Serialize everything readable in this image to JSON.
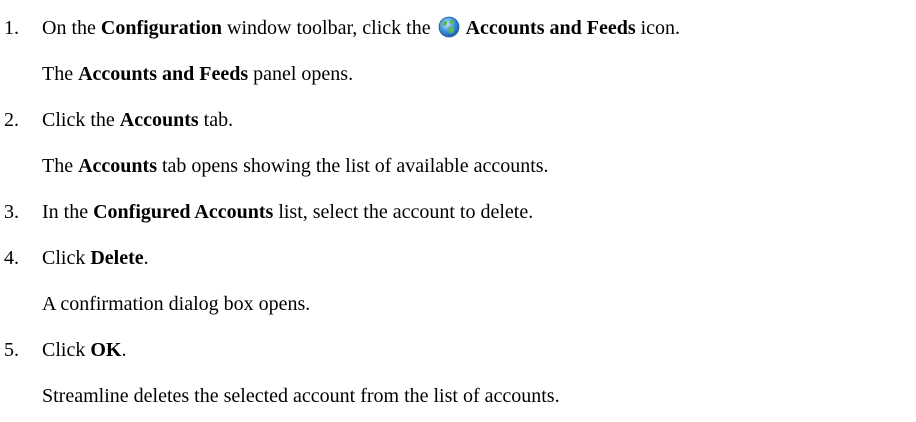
{
  "steps": [
    {
      "number": "1.",
      "parts": [
        "On the ",
        "Configuration",
        " window toolbar, click the ",
        "Accounts and Feeds",
        " icon."
      ],
      "icon": "globe-icon",
      "result_parts": [
        "The ",
        "Accounts and Feeds",
        " panel opens."
      ]
    },
    {
      "number": "2.",
      "parts": [
        "Click the ",
        "Accounts",
        " tab."
      ],
      "result_parts": [
        "The ",
        "Accounts",
        " tab opens showing the list of available accounts."
      ]
    },
    {
      "number": "3.",
      "parts": [
        "In the ",
        "Configured Accounts",
        " list, select the account to delete."
      ]
    },
    {
      "number": "4.",
      "parts": [
        "Click ",
        "Delete",
        "."
      ],
      "result": "A confirmation dialog box opens."
    },
    {
      "number": "5.",
      "parts": [
        "Click ",
        "OK",
        "."
      ],
      "result": "Streamline deletes the selected account from the list of accounts."
    }
  ],
  "colors": {
    "text": "#000000",
    "globe_blue": "#3a8fd8",
    "globe_green": "#5cb85c"
  }
}
